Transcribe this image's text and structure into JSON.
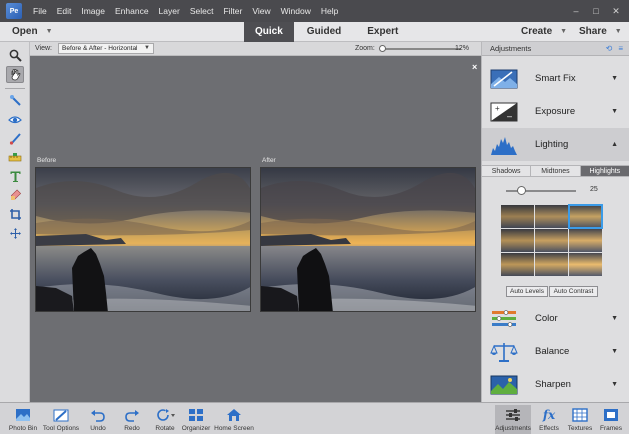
{
  "menu": {
    "logo": "Pe",
    "items": [
      "File",
      "Edit",
      "Image",
      "Enhance",
      "Layer",
      "Select",
      "Filter",
      "View",
      "Window",
      "Help"
    ],
    "window_controls": [
      "–",
      "□",
      "✕"
    ]
  },
  "modebar": {
    "open_label": "Open",
    "tabs": [
      "Quick",
      "Guided",
      "Expert"
    ],
    "active_tab": "Quick",
    "create_label": "Create",
    "share_label": "Share"
  },
  "options": {
    "view_label": "View:",
    "view_value": "Before & After - Horizontal",
    "zoom_label": "Zoom:",
    "zoom_value": "12%"
  },
  "canvas": {
    "before_label": "Before",
    "after_label": "After",
    "close_glyph": "×"
  },
  "panel": {
    "title": "Adjustments",
    "items": [
      "Smart Fix",
      "Exposure",
      "Lighting",
      "Color",
      "Balance",
      "Sharpen"
    ],
    "open_item": "Lighting",
    "subtabs": [
      "Shadows",
      "Midtones",
      "Highlights"
    ],
    "active_subtab": "Highlights",
    "amount_value": "25",
    "auto_levels": "Auto Levels",
    "auto_contrast": "Auto Contrast"
  },
  "bottom": {
    "buttons": [
      "Photo Bin",
      "Tool Options",
      "Undo",
      "Redo",
      "Rotate",
      "Organizer",
      "Home Screen"
    ],
    "right_buttons": [
      "Adjustments",
      "Effects",
      "Textures",
      "Frames"
    ],
    "active_right": "Adjustments"
  },
  "colors": {
    "accent": "#3b9be8",
    "icon_blue": "#2d6fc7",
    "canvas_bg": "#6d6e72"
  }
}
